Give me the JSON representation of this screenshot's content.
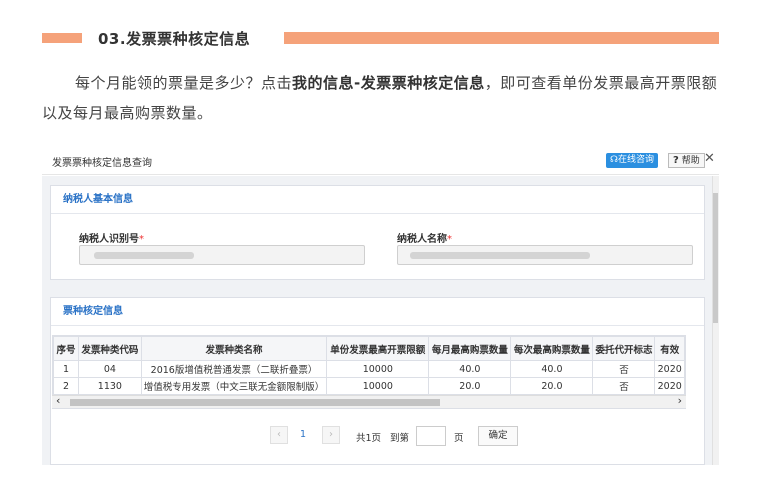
{
  "section": {
    "title": "03.发票票种核定信息",
    "accent_color": "#f5a27a"
  },
  "paragraph": {
    "before": "每个月能领的票量是多少？点击",
    "bold": "我的信息-发票票种核定信息",
    "after": "，即可查看单份发票最高开票限额以及每月最高购票数量。"
  },
  "window": {
    "title": "发票票种核定信息查询",
    "online_button": "在线咨询",
    "help_button": "帮助",
    "close_icon": "close-icon",
    "online_icon": "headset-icon"
  },
  "taxpayer_panel": {
    "heading": "纳税人基本信息",
    "id_label": "纳税人识别号",
    "name_label": "纳税人名称",
    "required_mark": "*"
  },
  "invoice_panel": {
    "heading": "票种核定信息",
    "columns": [
      "序号",
      "发票种类代码",
      "发票种类名称",
      "单份发票最高开票限额",
      "每月最高购票数量",
      "每次最高购票数量",
      "委托代开标志",
      "有效"
    ],
    "rows": [
      [
        "1",
        "04",
        "2016版增值税普通发票（二联折叠票）",
        "10000",
        "40.0",
        "40.0",
        "否",
        "2020"
      ],
      [
        "2",
        "1130",
        "增值税专用发票（中文三联无金额限制版）",
        "10000",
        "20.0",
        "20.0",
        "否",
        "2020"
      ]
    ]
  },
  "pager": {
    "prev": "‹",
    "page": "1",
    "next": "›",
    "total": "共1页",
    "goto": "到第",
    "page_unit": "页",
    "confirm": "确定"
  }
}
